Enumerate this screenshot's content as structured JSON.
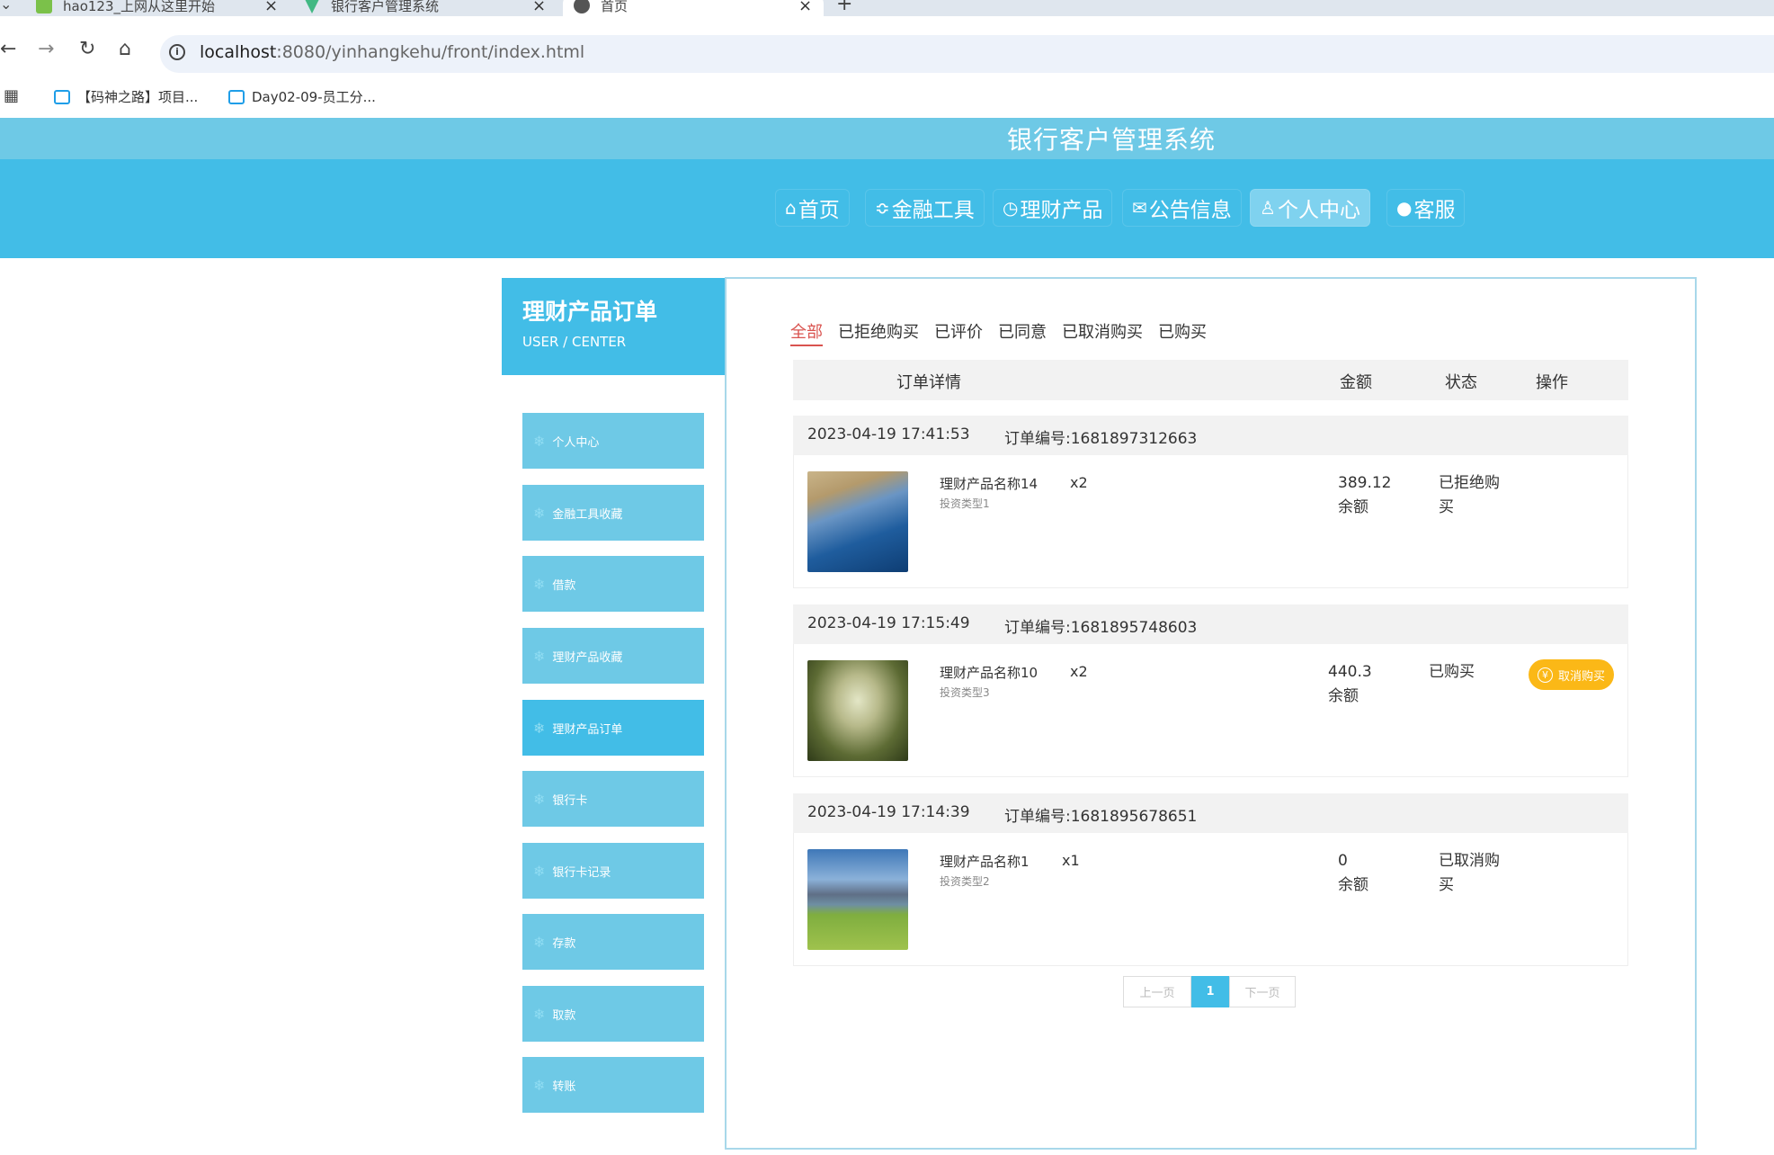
{
  "browser": {
    "tabs": [
      {
        "label": "hao123_上网从这里开始"
      },
      {
        "label": "银行客户管理系统"
      },
      {
        "label": "首页"
      }
    ],
    "new_tab": "+",
    "close_glyph": "×",
    "url_host": "localhost",
    "url_rest": ":8080/yinhangkehu/front/index.html",
    "bookmarks": [
      {
        "label": "【码神之路】项目..."
      },
      {
        "label": "Day02-09-员工分..."
      }
    ]
  },
  "site": {
    "title": "银行客户管理系统",
    "nav": [
      {
        "label": "首页",
        "icon": "⌂"
      },
      {
        "label": "金融工具",
        "icon": "≎"
      },
      {
        "label": "理财产品",
        "icon": "◷"
      },
      {
        "label": "公告信息",
        "icon": "✉"
      },
      {
        "label": "个人中心",
        "icon": "♙"
      },
      {
        "label": "客服",
        "icon": "●"
      }
    ]
  },
  "sidebar": {
    "title": "理财产品订单",
    "subtitle": "USER / CENTER",
    "items": [
      {
        "label": "个人中心"
      },
      {
        "label": "金融工具收藏"
      },
      {
        "label": "借款"
      },
      {
        "label": "理财产品收藏"
      },
      {
        "label": "理财产品订单"
      },
      {
        "label": "银行卡"
      },
      {
        "label": "银行卡记录"
      },
      {
        "label": "存款"
      },
      {
        "label": "取款"
      },
      {
        "label": "转账"
      }
    ]
  },
  "filters": [
    {
      "label": "全部"
    },
    {
      "label": "已拒绝购买"
    },
    {
      "label": "已评价"
    },
    {
      "label": "已同意"
    },
    {
      "label": "已取消购买"
    },
    {
      "label": "已购买"
    }
  ],
  "table_headers": {
    "detail": "订单详情",
    "amount": "金额",
    "status": "状态",
    "action": "操作"
  },
  "orders": [
    {
      "date": "2023-04-19 17:41:53",
      "order_no": "订单编号:1681897312663",
      "name": "理财产品名称14",
      "type": "投资类型1",
      "qty": "x2",
      "amount": "389.12",
      "amount_unit": "余额",
      "status": "已拒绝购买",
      "image": "coast-aerial"
    },
    {
      "date": "2023-04-19 17:15:49",
      "order_no": "订单编号:1681895748603",
      "name": "理财产品名称10",
      "type": "投资类型3",
      "qty": "x2",
      "amount": "440.3",
      "amount_unit": "余额",
      "status": "已购买",
      "action": "取消购买",
      "image": "forest-path"
    },
    {
      "date": "2023-04-19 17:14:39",
      "order_no": "订单编号:1681895678651",
      "name": "理财产品名称1",
      "type": "投资类型2",
      "qty": "x1",
      "amount": "0",
      "amount_unit": "余额",
      "status": "已取消购买",
      "image": "mountain-meadow"
    }
  ],
  "pagination": {
    "prev": "上一页",
    "current": "1",
    "next": "下一页"
  },
  "colors": {
    "primary": "#42bde7",
    "light": "#6ec9e6",
    "accent_red": "#d9534f",
    "cancel_button": "#fbb817"
  }
}
